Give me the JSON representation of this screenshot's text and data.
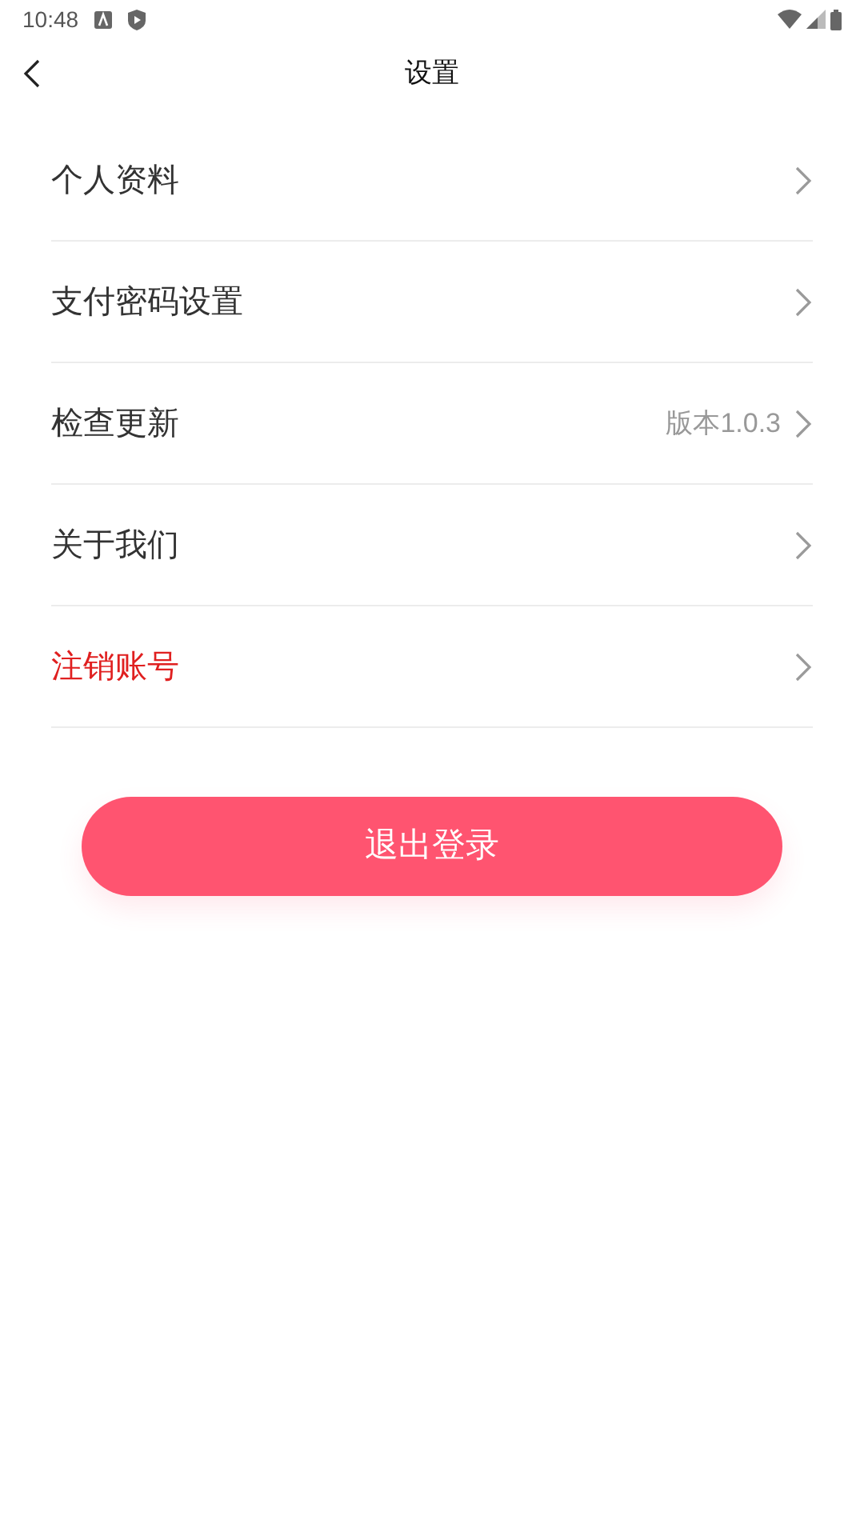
{
  "status_bar": {
    "time": "10:48"
  },
  "header": {
    "title": "设置"
  },
  "items": [
    {
      "label": "个人资料",
      "kind": "normal"
    },
    {
      "label": "支付密码设置",
      "kind": "normal"
    },
    {
      "label": "检查更新",
      "kind": "normal",
      "value": "版本1.0.3"
    },
    {
      "label": "关于我们",
      "kind": "normal"
    },
    {
      "label": "注销账号",
      "kind": "danger"
    }
  ],
  "logout_button": {
    "label": "退出登录"
  }
}
